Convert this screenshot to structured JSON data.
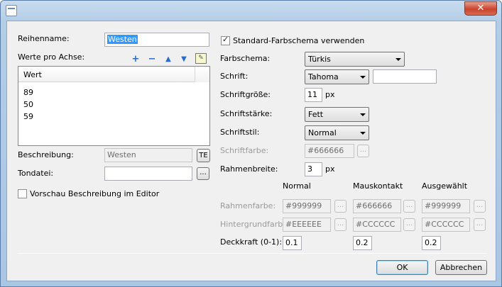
{
  "window": {
    "icon": "app-icon",
    "close_label": "✕"
  },
  "left": {
    "series_name_label": "Reihenname:",
    "series_name_value": "Westen",
    "values_label": "Werte pro Achse:",
    "toolbar_icons": [
      "plus-icon",
      "minus-icon",
      "arrow-up-icon",
      "arrow-down-icon",
      "edit-icon"
    ],
    "list_header": "Wert",
    "list_values": [
      "89",
      "50",
      "59"
    ],
    "description_label": "Beschreibung:",
    "description_value": "Westen",
    "te_button": "TE",
    "sound_label": "Tondatei:",
    "sound_value": "",
    "browse_label": "...",
    "preview_checkbox_label": "Vorschau Beschreibung im Editor"
  },
  "right": {
    "standard_scheme_label": "Standard-Farbschema verwenden",
    "scheme_label": "Farbschema:",
    "scheme_value": "Türkis",
    "font_label": "Schrift:",
    "font_value": "Tahoma",
    "font_extra": "",
    "fontsize_label": "Schriftgröße:",
    "fontsize_value": "11",
    "fontsize_unit": "px",
    "fontweight_label": "Schriftstärke:",
    "fontweight_value": "Fett",
    "fontstyle_label": "Schriftstil:",
    "fontstyle_value": "Normal",
    "fontcolor_label": "Schriftfarbe:",
    "fontcolor_value": "#666666",
    "border_width_label": "Rahmenbreite:",
    "border_width_value": "3",
    "border_width_unit": "px",
    "col_normal": "Normal",
    "col_hover": "Mauskontakt",
    "col_selected": "Ausgewählt",
    "border_color_label": "Rahmenfarbe:",
    "border_colors": [
      "#999999",
      "#666666",
      "#999999"
    ],
    "bg_color_label": "Hintergrundfarbe:",
    "bg_colors": [
      "#EEEEEE",
      "#CCCCCC",
      "#CCCCCC"
    ],
    "opacity_label": "Deckkraft (0-1):",
    "opacity_values": [
      "0.1",
      "0.2",
      "0.2"
    ],
    "browse_label": "..."
  },
  "footer": {
    "ok_label": "OK",
    "cancel_label": "Abbrechen"
  },
  "colors": {
    "accent": "#3399ff",
    "title_bar": "#b3cde7",
    "close": "#c8432c"
  }
}
